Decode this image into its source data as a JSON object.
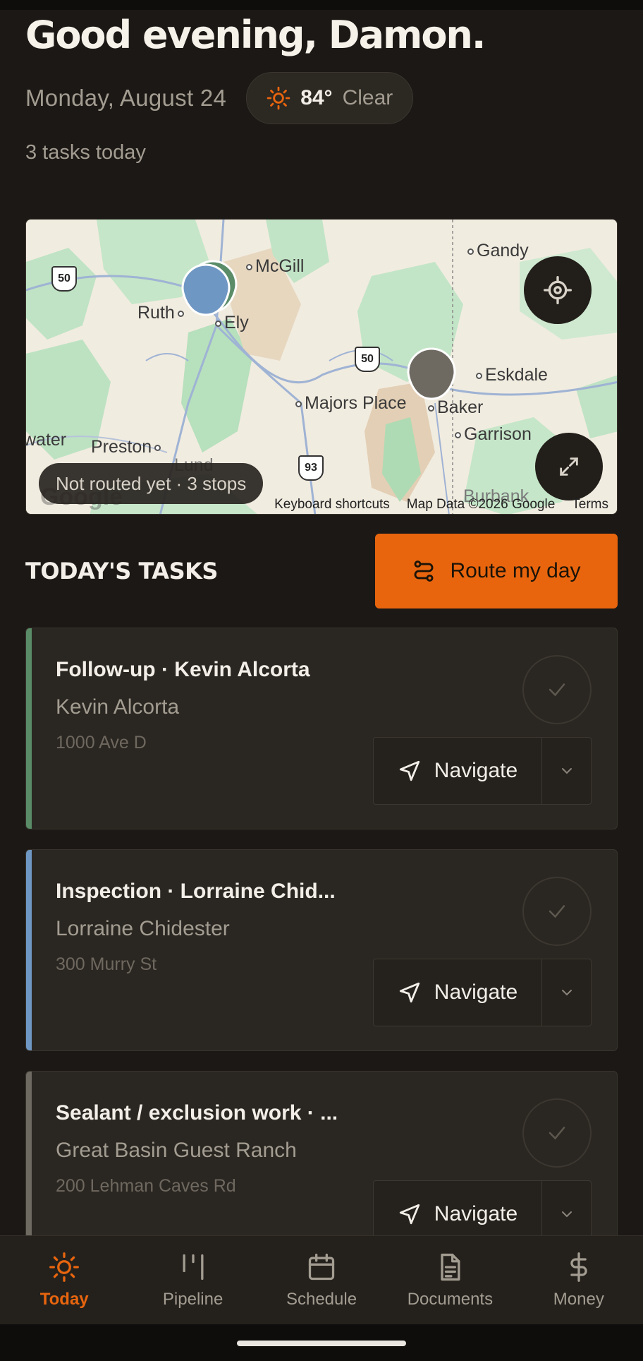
{
  "header": {
    "greeting": "Good evening, Damon.",
    "date": "Monday, August 24",
    "weather": {
      "temp": "84°",
      "condition": "Clear",
      "icon": "sun-icon"
    },
    "task_count": "3 tasks today"
  },
  "map": {
    "towns": [
      "Gandy",
      "McGill",
      "Ruth",
      "Ely",
      "Eskdale",
      "Majors Place",
      "Baker",
      "Garrison",
      "Preston",
      "Lund",
      "Burbank",
      "water"
    ],
    "route_shields": [
      "50",
      "50",
      "93"
    ],
    "route_status": "Not routed yet · 3 stops",
    "watermark": "Google",
    "footer": {
      "shortcuts": "Keyboard shortcuts",
      "data": "Map Data ©2026 Google",
      "terms": "Terms"
    },
    "marker_colors": [
      "#6f97c4",
      "#5a8c68",
      "#6e6a62"
    ]
  },
  "tasks_section": {
    "title": "TODAY'S TASKS",
    "route_button": "Route my day"
  },
  "tasks": [
    {
      "title": "Follow-up · Kevin Alcorta",
      "client": "Kevin Alcorta",
      "address": "1000 Ave D",
      "accent": "#5a8c68",
      "action": "Navigate"
    },
    {
      "title": "Inspection · Lorraine Chid...",
      "client": "Lorraine Chidester",
      "address": "300 Murry St",
      "accent": "#6f97c4",
      "action": "Navigate"
    },
    {
      "title": "Sealant / exclusion work · ...",
      "client": "Great Basin Guest Ranch",
      "address": "200 Lehman Caves Rd",
      "accent": "#6e6a62",
      "action": "Navigate"
    }
  ],
  "bottom_nav": [
    {
      "label": "Today",
      "icon": "sun-icon",
      "active": true
    },
    {
      "label": "Pipeline",
      "icon": "pipeline-icon",
      "active": false
    },
    {
      "label": "Schedule",
      "icon": "calendar-icon",
      "active": false
    },
    {
      "label": "Documents",
      "icon": "document-icon",
      "active": false
    },
    {
      "label": "Money",
      "icon": "dollar-icon",
      "active": false
    }
  ],
  "colors": {
    "accent": "#e8650e",
    "background": "#1b1815",
    "card": "#2a2722"
  }
}
